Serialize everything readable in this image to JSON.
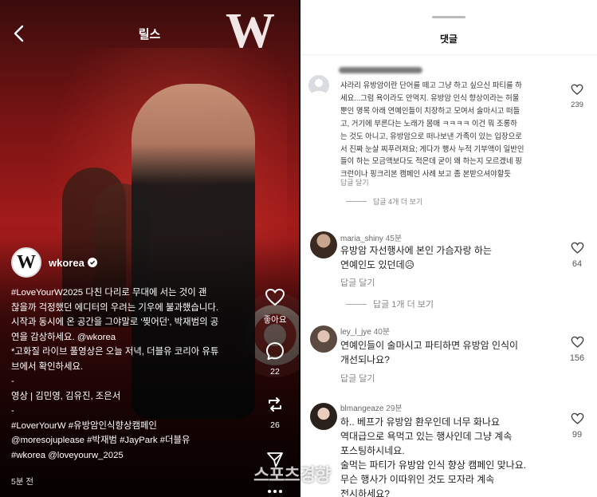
{
  "reels": {
    "header_title": "릴스",
    "author": {
      "username": "wkorea",
      "avatar_letter": "W",
      "verified": true
    },
    "caption_lines": [
      "#LoveYourW2025 다친 다리로 무대에 서는 것이 괜",
      "찮을까 걱정했던 에디터의 우려는 기우에 불과했습니다.",
      "시작과 동시에 온 공간을 그야말로 '찢어던', 박재범의 공",
      "연을 감상하세요. @wkorea",
      "*고화질 라이브 풀영상은 오늘 저녁, 더블유 코리아 유튜",
      "브에서 확인하세요.",
      "-",
      "영상 | 김민영, 김유진, 조은서",
      "-",
      "#LoverYourW #유방암인식향상캠페인",
      "@moresojuplease #박재범 #JayPark #더블유",
      "#wkorea @loveyourw_2025"
    ],
    "time_ago": "5분 전",
    "actions": {
      "like_label": "좋아요",
      "comment_count": "22",
      "repost_count": "26"
    },
    "bg_logo": "W"
  },
  "comments_panel": {
    "title": "댓글",
    "comments": [
      {
        "username": "",
        "time": "",
        "lines": [
          "샤라리 유방암이란 단어를 떼고 그냥 하고 싶으신 파티를 하",
          "세요...그럼 욕이라도 안먹지. 유방암 인식 향상이라는 허울",
          "뿐인 명목 아래 연예인들이 치장하고 모여서 술마시고 떠들",
          "고, 거기에 부른다는 노래가 몸매 ㅋㅋㅋㅋ 이건 뭐 조롱하",
          "는 것도 아니고, 유방암으로 떠나보낸 가족이 있는 입장으로",
          "서 진짜 눈살 찌푸려져요; 게다가 행사 누적 기부액이 일반인",
          "들이 하는 모금액보다도 적은데 굳이 왜 하는지 모르겠네 핑",
          "크런이나 핑크리본 캠페인 사례 보고 좀 본받으셔야할듯"
        ],
        "reply_label": "답글 달기",
        "more_replies": "답글 4개 더 보기",
        "likes": "239"
      },
      {
        "username": "maria_shiny",
        "time": "45분",
        "lines": [
          "유방암 자선행사에 본인 가슴자랑 하는",
          "연예인도 있던데😥"
        ],
        "reply_label": "답글 달기",
        "more_replies": "답글 1개 더 보기",
        "likes": "64"
      },
      {
        "username": "ley_l_jye",
        "time": "40분",
        "lines": [
          "연예인들이 술마시고 파티하면 유방암 인식이",
          "개선되나요?"
        ],
        "reply_label": "답글 달기",
        "likes": "156"
      },
      {
        "username": "blmangeaze",
        "time": "29분",
        "lines": [
          "하.. 베프가 유방암 환우인데 너무 화나요",
          "역대급으로 욕먹고 있는 행사인데 그냥 계속",
          "포스팅하시네요.",
          "술먹는 파티가 유방암 인식 향상 캠페인 맞나요.",
          "무슨 행사가 이따위인 것도 모자라 계속",
          "전시하세요?"
        ],
        "likes": "99"
      }
    ]
  },
  "watermark": "스포츠경향",
  "colors": {
    "accent_red": "#a31b1b",
    "text_dark": "#222222",
    "muted": "#888888"
  }
}
